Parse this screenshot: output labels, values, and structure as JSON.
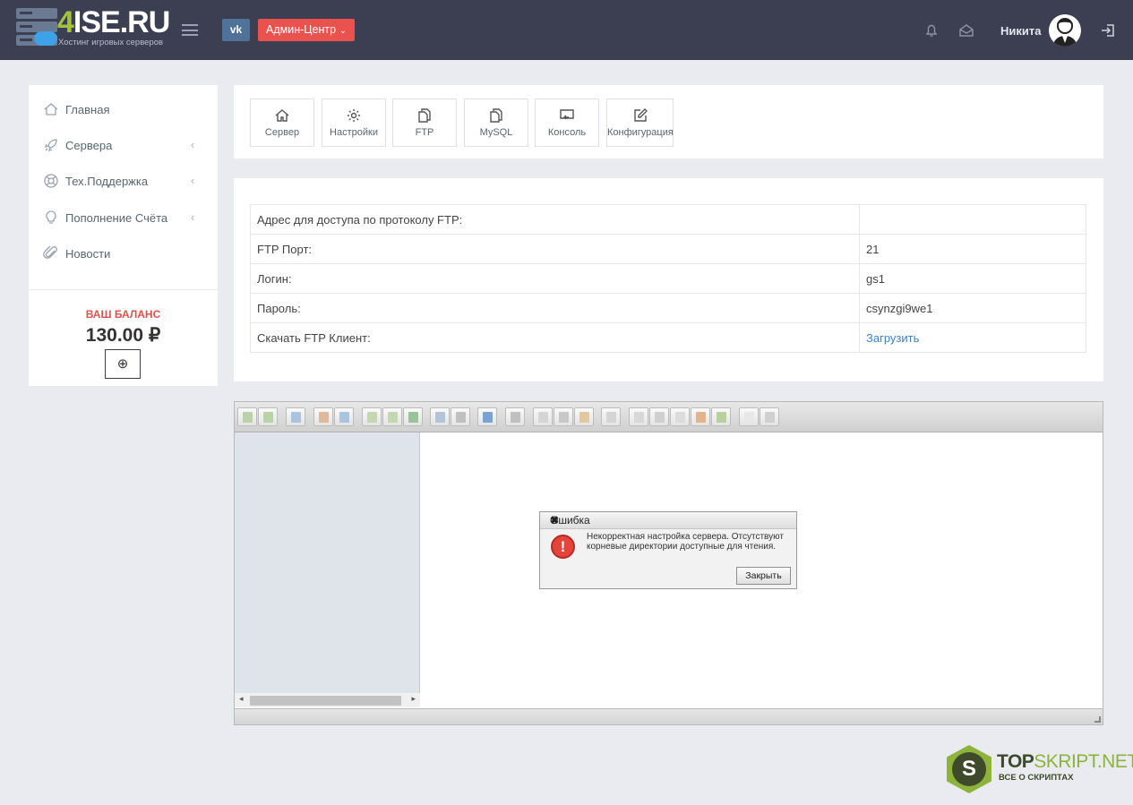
{
  "header": {
    "logo_text_prefix": "4",
    "logo_text": "ISE.RU",
    "logo_subtitle": "Хостинг игровых серверов",
    "vk_label": "vk",
    "admin_label": "Админ-Центр",
    "user_name": "Никита"
  },
  "sidebar": {
    "items": [
      {
        "label": "Главная",
        "icon": "home-icon",
        "has_submenu": false
      },
      {
        "label": "Сервера",
        "icon": "rocket-icon",
        "has_submenu": true
      },
      {
        "label": "Тех.Поддержка",
        "icon": "lifebuoy-icon",
        "has_submenu": true
      },
      {
        "label": "Пополнение Счёта",
        "icon": "lightbulb-icon",
        "has_submenu": true
      },
      {
        "label": "Новости",
        "icon": "paperclip-icon",
        "has_submenu": false
      }
    ],
    "balance_title": "ВАШ БАЛАНС",
    "balance_value": "130.00 ₽",
    "add_button": "⊕"
  },
  "tabs": [
    {
      "label": "Сервер",
      "icon": "home-icon"
    },
    {
      "label": "Настройки",
      "icon": "gear-icon"
    },
    {
      "label": "FTP",
      "icon": "files-icon"
    },
    {
      "label": "MySQL",
      "icon": "files-icon"
    },
    {
      "label": "Консоль",
      "icon": "console-icon"
    },
    {
      "label": "Конфигурация",
      "icon": "edit-icon"
    }
  ],
  "ftp_info": {
    "rows": [
      {
        "label": "Адрес для доступа по протоколу FTP:",
        "value": ""
      },
      {
        "label": "FTP Порт:",
        "value": "21"
      },
      {
        "label": "Логин:",
        "value": "gs1"
      },
      {
        "label": "Пароль:",
        "value": "csynzgi9we1"
      },
      {
        "label": "Скачать FTP Клиент:",
        "value": "Загрузить",
        "is_link": true
      }
    ]
  },
  "dialog": {
    "title": "Ошибка",
    "message": "Некорректная настройка сервера. Отсутствуют корневые директории доступные для чтения.",
    "close_button": "Закрыть",
    "close_glyph": "✖",
    "icon_glyph": "!"
  },
  "watermark": {
    "letter": "S",
    "top": "TOP",
    "brand": "SKRIPT.NET",
    "tagline": "ВСЕ О СКРИПТАХ"
  },
  "colors": {
    "topbar": "#3b3f51",
    "admin_button": "#e9524d",
    "vk_button": "#507299",
    "balance_title": "#d9534f",
    "link": "#3d80c6"
  }
}
